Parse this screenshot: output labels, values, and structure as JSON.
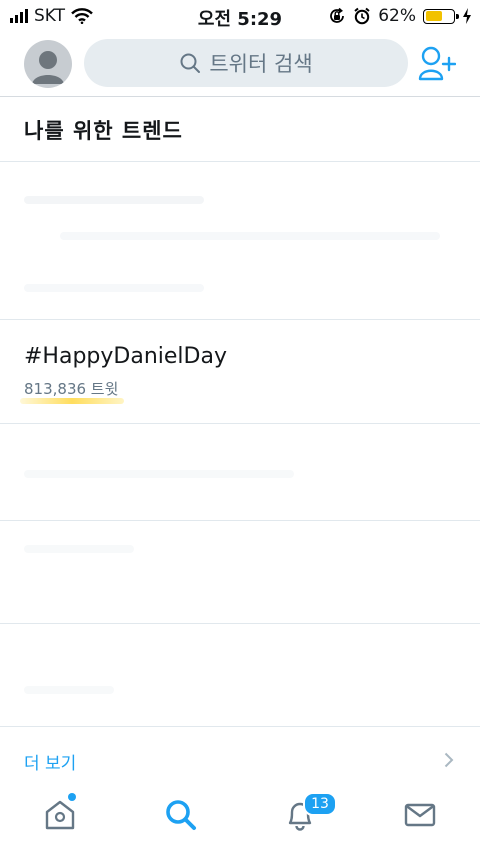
{
  "status_bar": {
    "carrier": "SKT",
    "time": "오전 5:29",
    "battery_percent": "62%",
    "battery_level": 0.62,
    "battery_color": "#f2c200"
  },
  "header": {
    "search_placeholder": "트위터 검색",
    "icons": [
      "avatar-icon",
      "search-icon",
      "add-user-icon"
    ]
  },
  "section_title": "나를 위한 트렌드",
  "trends": [
    {
      "hashtag": "#HappyDanielDay",
      "count": "813,836 트윗"
    }
  ],
  "show_more": "더 보기",
  "tab_bar": {
    "tabs": [
      "home-icon",
      "search-icon",
      "notifications-icon",
      "messages-icon"
    ],
    "active": "search-icon",
    "notification_badge": "13",
    "accent_color": "#1da1f2"
  }
}
